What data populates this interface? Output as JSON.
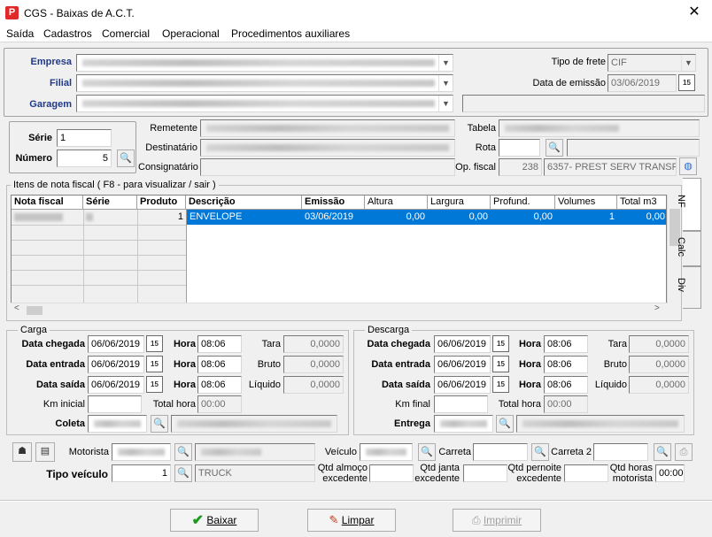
{
  "window": {
    "title": "CGS - Baixas de A.C.T.",
    "close_label": "✕"
  },
  "menu": [
    "Saída",
    "Cadastros",
    "Comercial",
    "Operacional",
    "Procedimentos auxiliares"
  ],
  "header": {
    "empresa_label": "Empresa",
    "filial_label": "Filial",
    "garagem_label": "Garagem",
    "tipo_frete_label": "Tipo de frete",
    "tipo_frete_value": "CIF",
    "data_emissao_label": "Data de emissão",
    "data_emissao_value": "03/06/2019"
  },
  "doc": {
    "serie_label": "Série",
    "serie_value": "1",
    "numero_label": "Número",
    "numero_value": "5",
    "remetente_label": "Remetente",
    "destinatario_label": "Destinatário",
    "consignatario_label": "Consignatário",
    "tabela_label": "Tabela",
    "rota_label": "Rota",
    "op_fiscal_label": "Op. fiscal",
    "op_fiscal_code": "238",
    "op_fiscal_desc": "6357- PREST SERV TRANSP"
  },
  "items": {
    "title": "Itens de nota fiscal ( F8 - para visualizar / sair )",
    "columns": [
      "Nota fiscal",
      "Série",
      "Produto",
      "Descrição",
      "Emissão",
      "Altura",
      "Largura",
      "Profund.",
      "Volumes",
      "Total m3"
    ],
    "row": {
      "produto": "1",
      "descricao": "ENVELOPE",
      "emissao": "03/06/2019",
      "altura": "0,00",
      "largura": "0,00",
      "profund": "0,00",
      "volumes": "1",
      "total_m3": "0,00"
    }
  },
  "side_tabs": [
    "NF",
    "Calc",
    "Div"
  ],
  "carga": {
    "title": "Carga",
    "data_chegada_label": "Data chegada",
    "data_chegada": "06/06/2019",
    "data_entrada_label": "Data entrada",
    "data_entrada": "06/06/2019",
    "data_saida_label": "Data saída",
    "data_saida": "06/06/2019",
    "hora_label": "Hora",
    "hora1": "08:06",
    "hora2": "08:06",
    "hora3": "08:06",
    "tara_label": "Tara",
    "tara": "0,0000",
    "bruto_label": "Bruto",
    "bruto": "0,0000",
    "liquido_label": "Líquido",
    "liquido": "0,0000",
    "km_label": "Km inicial",
    "total_hora_label": "Total hora",
    "total_hora": "00:00",
    "coleta_label": "Coleta"
  },
  "descarga": {
    "title": "Descarga",
    "data_chegada_label": "Data chegada",
    "data_chegada": "06/06/2019",
    "data_entrada_label": "Data entrada",
    "data_entrada": "06/06/2019",
    "data_saida_label": "Data saída",
    "data_saida": "06/06/2019",
    "hora_label": "Hora",
    "hora1": "08:06",
    "hora2": "08:06",
    "hora3": "08:06",
    "tara_label": "Tara",
    "tara": "0,0000",
    "bruto_label": "Bruto",
    "bruto": "0,0000",
    "liquido_label": "Líquido",
    "liquido": "0,0000",
    "km_label": "Km final",
    "total_hora_label": "Total hora",
    "total_hora": "00:00",
    "entrega_label": "Entrega"
  },
  "transport": {
    "motorista_label": "Motorista",
    "veiculo_label": "Veículo",
    "carreta_label": "Carreta",
    "carreta2_label": "Carreta 2",
    "tipo_veiculo_label": "Tipo veículo",
    "tipo_veiculo_code": "1",
    "tipo_veiculo_desc": "TRUCK",
    "qtd_almoco_label1": "Qtd almoço",
    "qtd_almoco_label2": "excedente",
    "qtd_janta_label1": "Qtd janta",
    "qtd_janta_label2": "excedente",
    "qtd_pernoite_label1": "Qtd pernoite",
    "qtd_pernoite_label2": "excedente",
    "qtd_horas_label1": "Qtd horas",
    "qtd_horas_label2": "motorista",
    "qtd_horas_value": "00:00"
  },
  "actions": {
    "baixar": "Baixar",
    "limpar": "Limpar",
    "imprimir": "Imprimir"
  },
  "colors": {
    "accent_label": "#1f3a8a",
    "selection": "#0078d7",
    "app_icon": "#e02a2a"
  }
}
